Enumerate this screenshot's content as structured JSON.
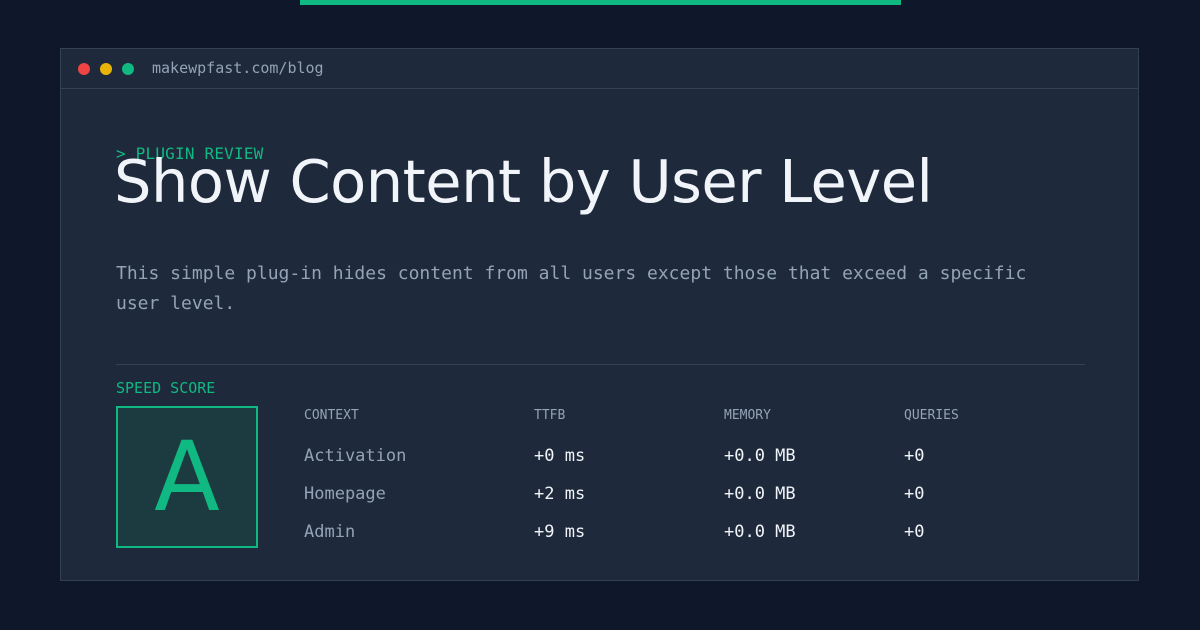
{
  "colors": {
    "background": "#0f172a",
    "card": "#1e293b",
    "border": "#334155",
    "accent": "#10b981",
    "traffic_red": "#ef4444",
    "traffic_yellow": "#eab308",
    "traffic_green": "#10b981"
  },
  "window": {
    "url": "makewpfast.com/blog"
  },
  "article": {
    "kicker": "> PLUGIN REVIEW",
    "title": "Show Content by User Level",
    "description": "This simple plug-in hides content from all users except those that exceed a specific user level."
  },
  "speed": {
    "label": "SPEED SCORE",
    "grade": "A"
  },
  "table": {
    "headers": [
      "CONTEXT",
      "TTFB",
      "MEMORY",
      "QUERIES"
    ],
    "rows": [
      [
        "Activation",
        "+0 ms",
        "+0.0 MB",
        "+0"
      ],
      [
        "Homepage",
        "+2 ms",
        "+0.0 MB",
        "+0"
      ],
      [
        "Admin",
        "+9 ms",
        "+0.0 MB",
        "+0"
      ]
    ]
  }
}
